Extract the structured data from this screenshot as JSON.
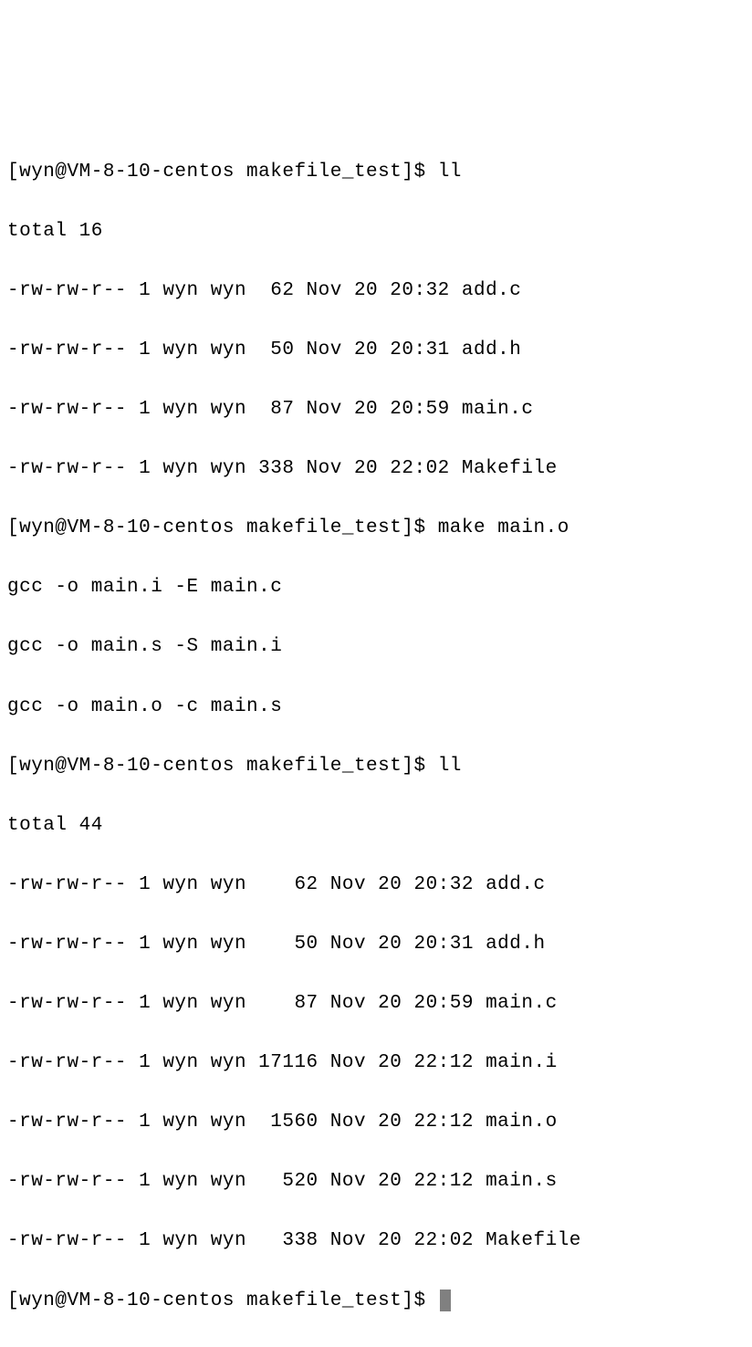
{
  "prompt": "[wyn@VM-8-10-centos makefile_test]$ ",
  "cmd1": "ll",
  "out1": [
    "total 16",
    "-rw-rw-r-- 1 wyn wyn  62 Nov 20 20:32 add.c",
    "-rw-rw-r-- 1 wyn wyn  50 Nov 20 20:31 add.h",
    "-rw-rw-r-- 1 wyn wyn  87 Nov 20 20:59 main.c",
    "-rw-rw-r-- 1 wyn wyn 338 Nov 20 22:02 Makefile"
  ],
  "cmd2": "make main.o",
  "out2": [
    "gcc -o main.i -E main.c",
    "gcc -o main.s -S main.i",
    "gcc -o main.o -c main.s"
  ],
  "cmd3": "ll",
  "out3": [
    "total 44",
    "-rw-rw-r-- 1 wyn wyn    62 Nov 20 20:32 add.c",
    "-rw-rw-r-- 1 wyn wyn    50 Nov 20 20:31 add.h",
    "-rw-rw-r-- 1 wyn wyn    87 Nov 20 20:59 main.c",
    "-rw-rw-r-- 1 wyn wyn 17116 Nov 20 22:12 main.i",
    "-rw-rw-r-- 1 wyn wyn  1560 Nov 20 22:12 main.o",
    "-rw-rw-r-- 1 wyn wyn   520 Nov 20 22:12 main.s",
    "-rw-rw-r-- 1 wyn wyn   338 Nov 20 22:02 Makefile"
  ]
}
